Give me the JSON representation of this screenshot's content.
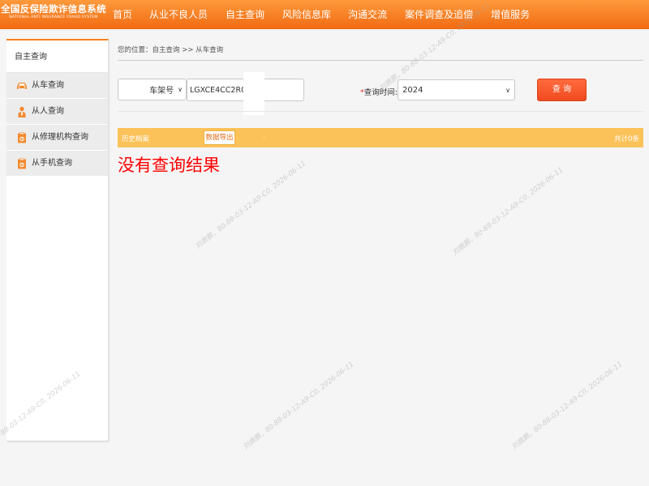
{
  "header": {
    "logo_cn": "全国反保险欺诈信息系统",
    "logo_en": "NATIONAL ANTI INSURANCE FRAUD SYSTEM",
    "nav": [
      "首页",
      "从业不良人员",
      "自主查询",
      "风险信息库",
      "沟通交流",
      "案件调查及追偿",
      "增值服务"
    ]
  },
  "sidebar": {
    "title": "自主查询",
    "items": [
      {
        "label": "从车查询",
        "icon": "car-icon"
      },
      {
        "label": "从人查询",
        "icon": "person-icon"
      },
      {
        "label": "从修理机构查询",
        "icon": "repair-shop-icon"
      },
      {
        "label": "从手机查询",
        "icon": "phone-icon"
      }
    ]
  },
  "breadcrumb": "您的位置：自主查询 >> 从车查询",
  "search": {
    "field_type": "车架号",
    "value": "LGXCE4CC2R036",
    "time_label": "查询时间:",
    "time_required_mark": "*",
    "year": "2024",
    "query_button": "查 询"
  },
  "results": {
    "title": "历史档案",
    "export_button": "数据导出",
    "marker": ".",
    "total": "共计0条",
    "empty_message": "没有查询结果"
  },
  "watermark": "刘鼎鹏，80-88-03-12-A9-C0, 2026-06-11",
  "colors": {
    "nav_orange": "#f58220",
    "result_bar": "#fcc25a",
    "query_button": "#ef4b1f",
    "empty_message": "#ff0000"
  }
}
